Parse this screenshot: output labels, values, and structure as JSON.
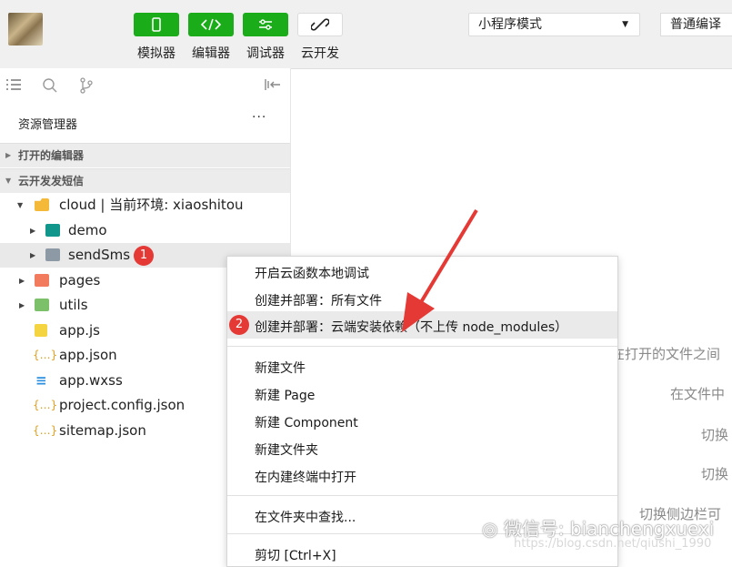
{
  "toolbar": {
    "buttons": [
      {
        "label": "模拟器",
        "icon": "phone-icon"
      },
      {
        "label": "编辑器",
        "icon": "code-icon"
      },
      {
        "label": "调试器",
        "icon": "sliders-icon"
      },
      {
        "label": "云开发",
        "icon": "cloud-link-icon"
      }
    ],
    "mode_select": "小程序模式",
    "compile_select": "普通编译"
  },
  "explorer": {
    "title": "资源管理器",
    "more": "···",
    "sections": [
      "打开的编辑器",
      "云开发发短信"
    ],
    "tree": [
      {
        "label": "cloud | 当前环境: xiaoshitou",
        "icon": "folder-open-icon"
      },
      {
        "label": "demo",
        "icon": "cloud-function-folder-icon"
      },
      {
        "label": "sendSms",
        "icon": "folder-icon",
        "badge": "1"
      },
      {
        "label": "pages",
        "icon": "pages-folder-icon"
      },
      {
        "label": "utils",
        "icon": "utils-folder-icon"
      },
      {
        "label": "app.js",
        "icon": "js-file-icon"
      },
      {
        "label": "app.json",
        "icon": "json-file-icon"
      },
      {
        "label": "app.wxss",
        "icon": "css-file-icon"
      },
      {
        "label": "project.config.json",
        "icon": "json-file-icon"
      },
      {
        "label": "sitemap.json",
        "icon": "json-file-icon"
      }
    ]
  },
  "context_menu": {
    "items": [
      "开启云函数本地调试",
      "创建并部署：所有文件",
      "创建并部署：云端安装依赖（不上传 node_modules）",
      "新建文件",
      "新建 Page",
      "新建 Component",
      "新建文件夹",
      "在内建终端中打开",
      "在文件夹中查找...",
      "剪切  [Ctrl+X]"
    ],
    "highlighted_badge": "2"
  },
  "background_hints": [
    "在打开的文件之间",
    "在文件中",
    "切换",
    "切换",
    "切换侧边栏可"
  ],
  "watermark": {
    "main": "微信号: bianchengxuexi",
    "url": "https://blog.csdn.net/qiushi_1990"
  },
  "colors": {
    "accent_green": "#1aad19",
    "badge_red": "#e53935",
    "arrow_red": "#e53935"
  }
}
